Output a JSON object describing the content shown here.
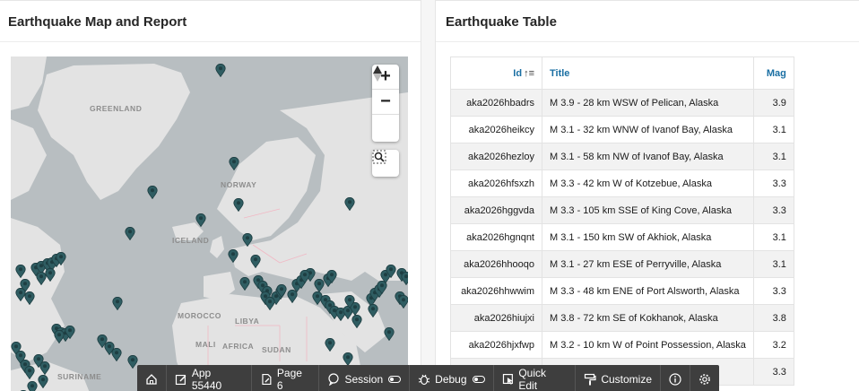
{
  "map_region": {
    "title": "Earthquake Map and Report",
    "labels": {
      "greenland": "GREENLAND",
      "norway": "NORWAY",
      "iceland": "ICELAND",
      "morocco": "MOROCCO",
      "libya": "LIBYA",
      "mali": "MALI",
      "africa": "AFRICA",
      "sudan": "SUDAN",
      "suriname": "SURINAME"
    },
    "controls": {
      "zoom_in": "+",
      "zoom_out": "−"
    }
  },
  "table_region": {
    "title": "Earthquake Table",
    "columns": {
      "id": "Id",
      "title": "Title",
      "mag": "Mag"
    },
    "rows": [
      {
        "id": "aka2026hbadrs",
        "title": "M 3.9 - 28 km WSW of Pelican, Alaska",
        "mag": "3.9"
      },
      {
        "id": "aka2026heikcy",
        "title": "M 3.1 - 32 km WNW of Ivanof Bay, Alaska",
        "mag": "3.1"
      },
      {
        "id": "aka2026hezloy",
        "title": "M 3.1 - 58 km NW of Ivanof Bay, Alaska",
        "mag": "3.1"
      },
      {
        "id": "aka2026hfsxzh",
        "title": "M 3.3 - 42 km W of Kotzebue, Alaska",
        "mag": "3.3"
      },
      {
        "id": "aka2026hggvda",
        "title": "M 3.3 - 105 km SSE of King Cove, Alaska",
        "mag": "3.3"
      },
      {
        "id": "aka2026hgnqnt",
        "title": "M 3.1 - 150 km SW of Akhiok, Alaska",
        "mag": "3.1"
      },
      {
        "id": "aka2026hhooqo",
        "title": "M 3.1 - 27 km ESE of Perryville, Alaska",
        "mag": "3.1"
      },
      {
        "id": "aka2026hhwwim",
        "title": "M 3.3 - 48 km ENE of Port Alsworth, Alaska",
        "mag": "3.3"
      },
      {
        "id": "aka2026hiujxi",
        "title": "M 3.8 - 72 km SE of Kokhanok, Alaska",
        "mag": "3.8"
      },
      {
        "id": "aka2026hjxfwp",
        "title": "M 3.2 - 10 km W of Point Possession, Alaska",
        "mag": "3.2"
      },
      {
        "id": "",
        "title": "",
        "mag": "3.3"
      }
    ]
  },
  "devbar": {
    "app": "App 55440",
    "page": "Page 6",
    "session": "Session",
    "debug": "Debug",
    "quick_edit": "Quick Edit",
    "customize": "Customize"
  },
  "colors": {
    "accent": "#1a6fa3",
    "pin": "#2f5d62",
    "toolbar": "#3e3e3e"
  }
}
